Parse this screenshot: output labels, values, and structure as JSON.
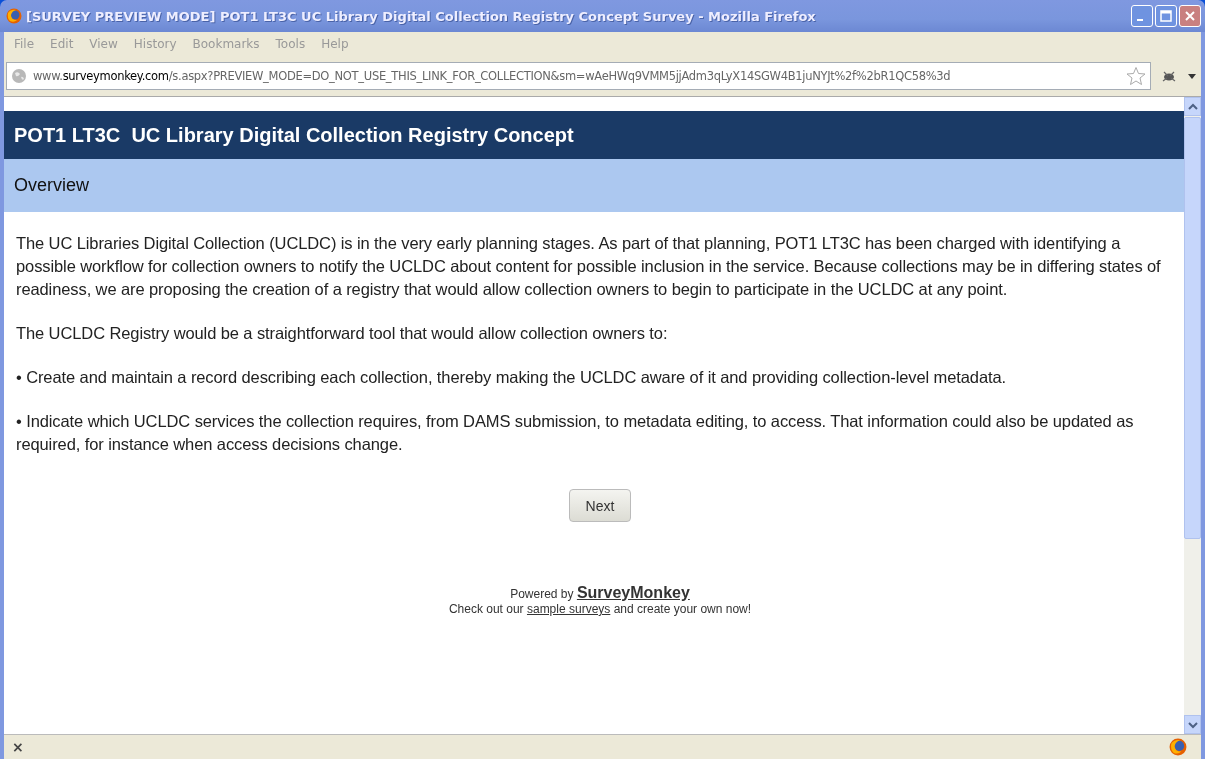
{
  "window": {
    "title": "[SURVEY PREVIEW MODE] POT1 LT3C  UC Library Digital Collection Registry Concept Survey - Mozilla Firefox"
  },
  "menu": [
    "File",
    "Edit",
    "View",
    "History",
    "Bookmarks",
    "Tools",
    "Help"
  ],
  "address_bar": {
    "url": "www.**surveymonkey.com**/s.aspx?PREVIEW_MODE=DO_NOT_USE_THIS_LINK_FOR_COLLECTION&sm=wAeHWq9VMM5jjAdm3qLyX14SGW4B1juNYJt%2f%2bR1QC58%3d"
  },
  "survey": {
    "title": "POT1 LT3C  UC Library Digital Collection Registry Concept",
    "section": "Overview",
    "paragraphs": [
      "The UC Libraries Digital Collection (UCLDC) is in the very early planning stages. As part of that planning, POT1 LT3C has been charged with identifying a possible workflow for collection owners to notify the UCLDC about content for possible inclusion in the service. Because collections may be in differing states of readiness, we are proposing the creation of a registry that would allow collection owners to begin to participate in the UCLDC at any point.",
      "The UCLDC Registry would be a straightforward tool that would allow collection owners to:",
      "• Create and maintain a record describing each collection, thereby making the UCLDC aware of it and providing collection-level metadata.",
      "• Indicate which UCLDC services the collection requires, from DAMS submission, to metadata editing, to access. That information could also be updated as required, for instance when access decisions change."
    ],
    "next_button": "Next"
  },
  "footer": {
    "powered_by": "Powered by",
    "brand": "SurveyMonkey",
    "line_start": "Check out our",
    "link": "sample surveys",
    "line_end": "and create your own now!"
  },
  "status_bar": {
    "text": "×"
  }
}
